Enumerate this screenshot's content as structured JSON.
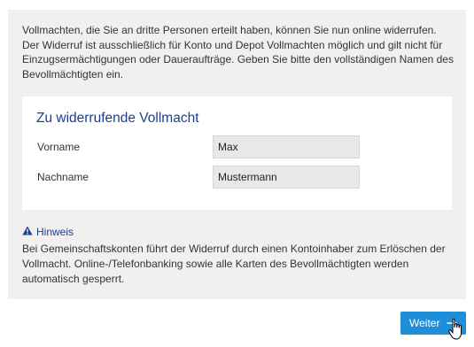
{
  "intro_text": "Vollmachten, die Sie an dritte Personen erteilt haben, können Sie nun online widerrufen. Der Widerruf ist ausschließlich für Konto und Depot Vollmachten möglich und gilt nicht für Einzugsermächtigungen oder Daueraufträge. Geben Sie bitte den vollständigen Namen des Bevollmächtigten ein.",
  "form": {
    "title": "Zu widerrufende Vollmacht",
    "first_name_label": "Vorname",
    "first_name_value": "Max",
    "last_name_label": "Nachname",
    "last_name_value": "Mustermann"
  },
  "hint": {
    "icon": "warning-icon",
    "title": "Hinweis",
    "text": "Bei Gemeinschaftskonten führt der Widerruf durch einen Kontoinhaber zum Erlöschen der Vollmacht. Online-/Telefonbanking sowie alle Karten des Bevollmächtigten werden automatisch gesperrt."
  },
  "actions": {
    "next_label": "Weiter",
    "next_icon": "arrow-right-icon"
  },
  "colors": {
    "accent": "#1b3f8b",
    "button": "#1e8ed8",
    "panel": "#f1f0ee"
  }
}
